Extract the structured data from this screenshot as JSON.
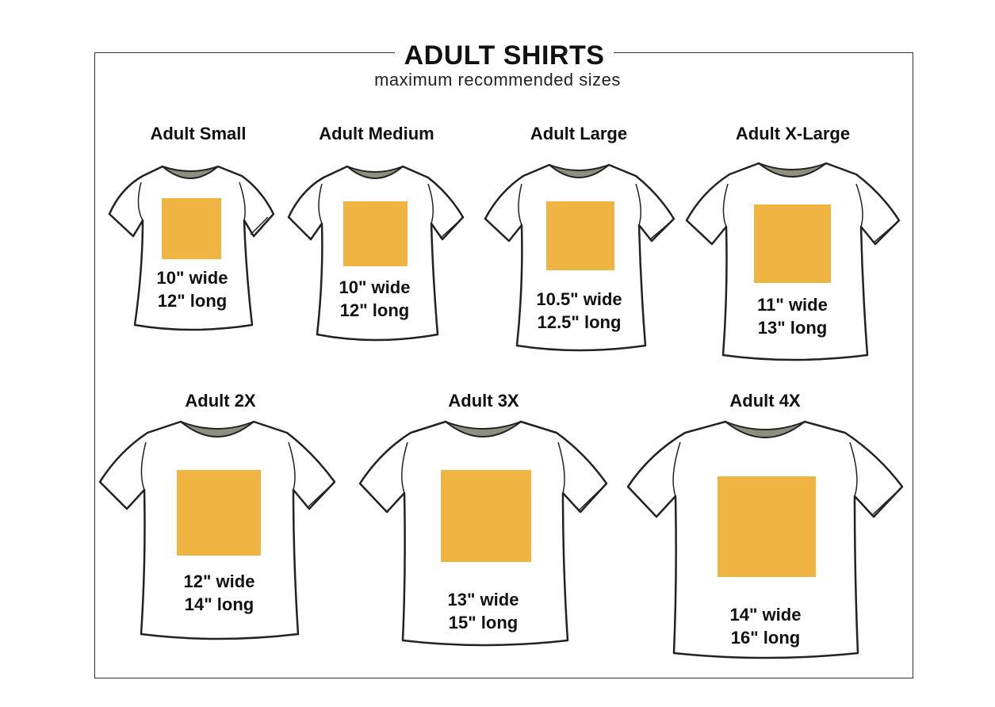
{
  "header": {
    "title": "ADULT SHIRTS",
    "subtitle": "maximum recommended sizes"
  },
  "colors": {
    "print_area": "#EFB442",
    "collar": "#8E8F7E",
    "outline": "#222222"
  },
  "shirts": [
    {
      "name": "Adult Small",
      "wide": "10\" wide",
      "long": "12\" long"
    },
    {
      "name": "Adult Medium",
      "wide": "10\" wide",
      "long": "12\" long"
    },
    {
      "name": "Adult Large",
      "wide": "10.5\" wide",
      "long": "12.5\" long"
    },
    {
      "name": "Adult X-Large",
      "wide": "11\" wide",
      "long": "13\" long"
    },
    {
      "name": "Adult 2X",
      "wide": "12\" wide",
      "long": "14\" long"
    },
    {
      "name": "Adult 3X",
      "wide": "13\" wide",
      "long": "15\" long"
    },
    {
      "name": "Adult 4X",
      "wide": "14\" wide",
      "long": "16\" long"
    }
  ]
}
